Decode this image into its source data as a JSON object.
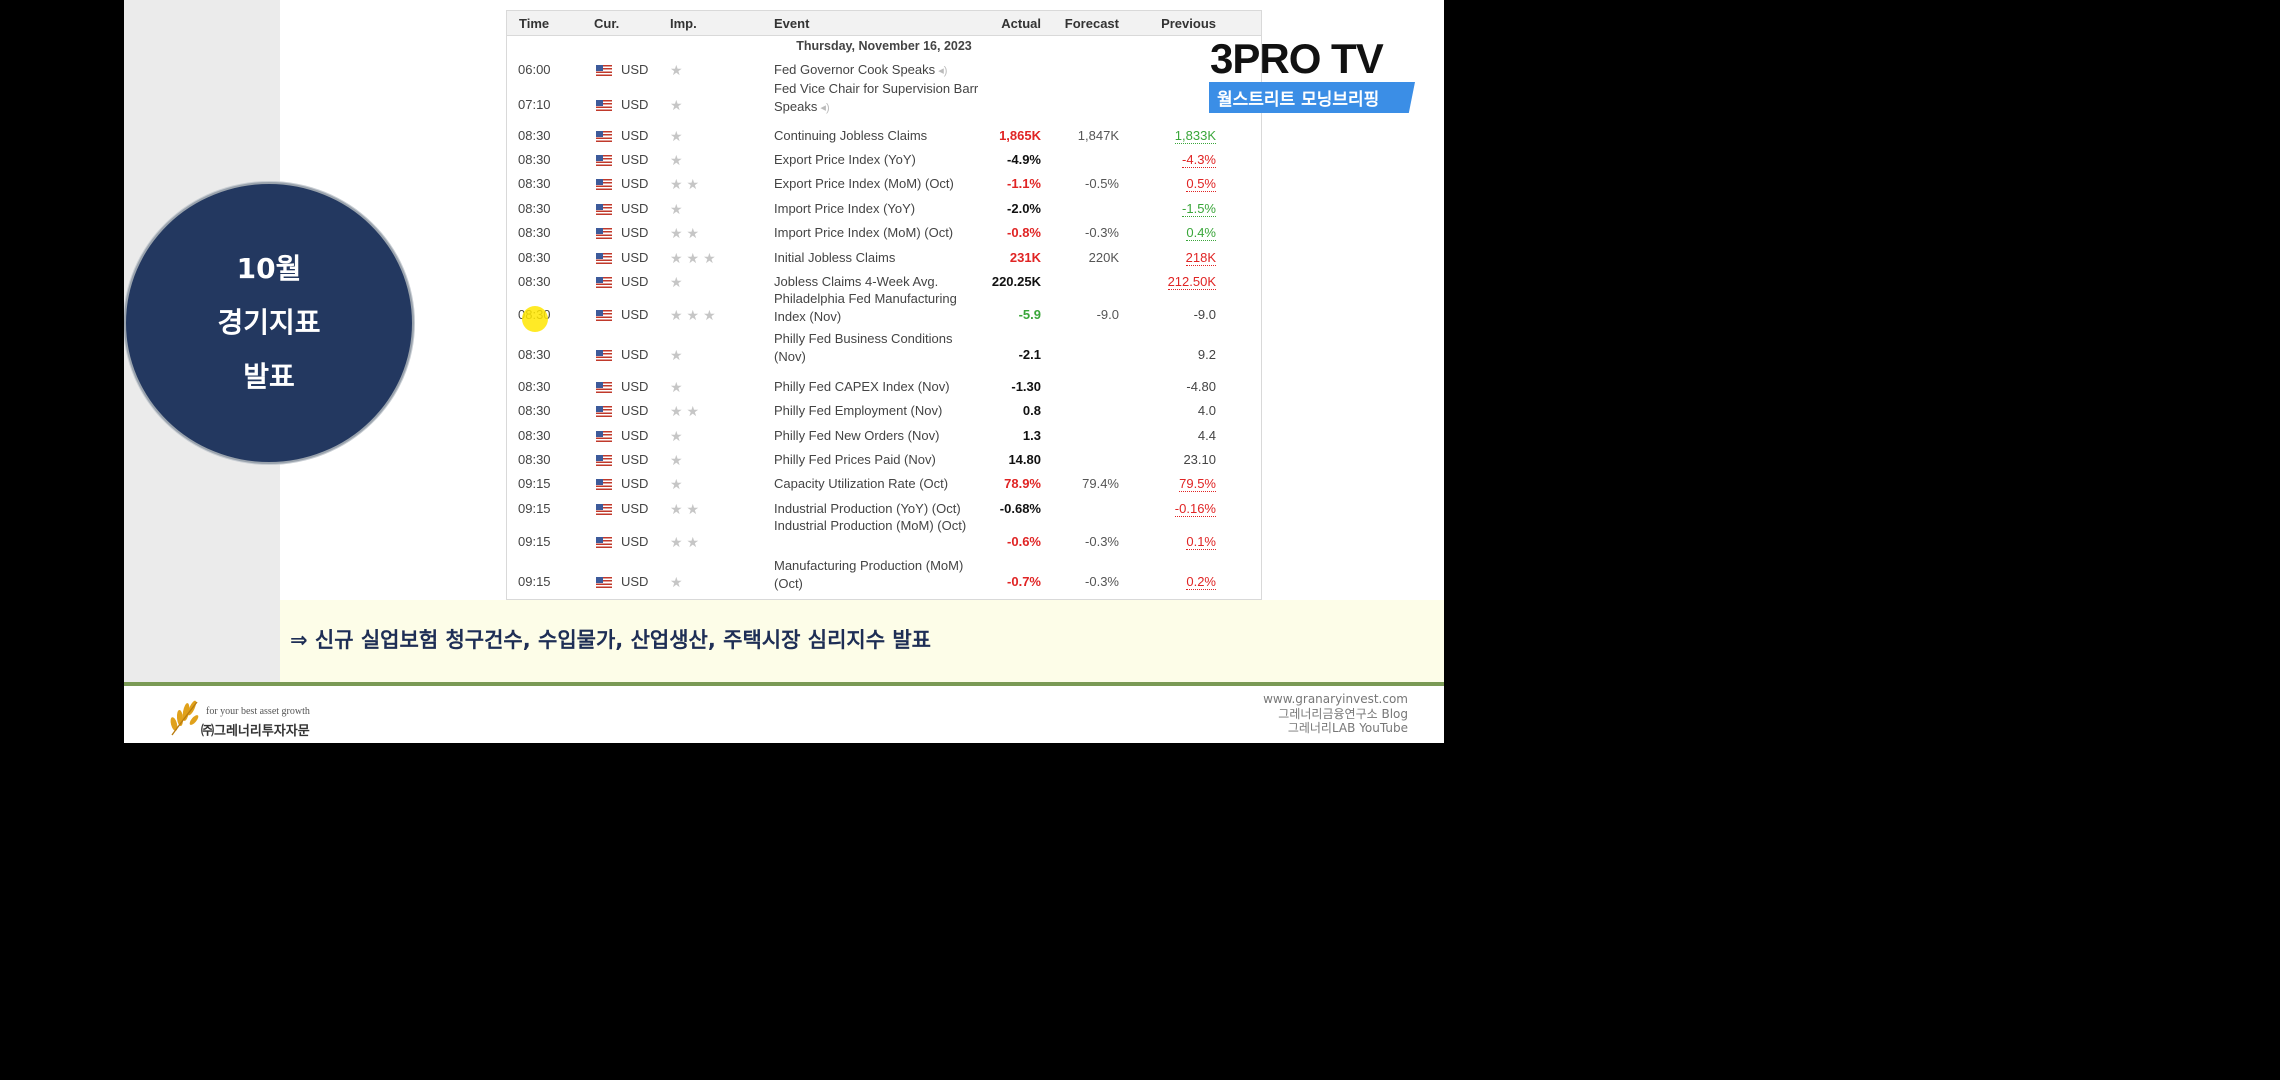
{
  "slide": {
    "circle_lines": [
      "10월",
      "경기지표",
      "발표"
    ],
    "caption": "⇒ 신규 실업보험 청구건수, 수입물가, 산업생산, 주택시장 심리지수 발표"
  },
  "logo": {
    "main": "3PRO TV",
    "sub": "월스트리트 모닝브리핑"
  },
  "calendar": {
    "headers": {
      "time": "Time",
      "cur": "Cur.",
      "imp": "Imp.",
      "event": "Event",
      "actual": "Actual",
      "forecast": "Forecast",
      "previous": "Previous"
    },
    "date": "Thursday, November 16, 2023",
    "rows": [
      {
        "time": "06:00",
        "cur": "USD",
        "imp": 1,
        "event": "Fed Governor Cook Speaks",
        "speech": true,
        "actual": "",
        "forecast": "",
        "previous": ""
      },
      {
        "time": "07:10",
        "cur": "USD",
        "imp": 1,
        "event": "Fed Vice Chair for Supervision Barr Speaks",
        "speech": true,
        "actual": "",
        "forecast": "",
        "previous": ""
      },
      {
        "time": "08:30",
        "cur": "USD",
        "imp": 1,
        "event": "Continuing Jobless Claims",
        "actual": "1,865K",
        "actual_color": "red",
        "forecast": "1,847K",
        "previous": "1,833K",
        "previous_color": "green"
      },
      {
        "time": "08:30",
        "cur": "USD",
        "imp": 1,
        "event": "Export Price Index (YoY)",
        "actual": "-4.9%",
        "actual_color": "black",
        "forecast": "",
        "previous": "-4.3%",
        "previous_color": "red"
      },
      {
        "time": "08:30",
        "cur": "USD",
        "imp": 2,
        "event": "Export Price Index (MoM) (Oct)",
        "actual": "-1.1%",
        "actual_color": "red",
        "forecast": "-0.5%",
        "previous": "0.5%",
        "previous_color": "red"
      },
      {
        "time": "08:30",
        "cur": "USD",
        "imp": 1,
        "event": "Import Price Index (YoY)",
        "actual": "-2.0%",
        "actual_color": "black",
        "forecast": "",
        "previous": "-1.5%",
        "previous_color": "green"
      },
      {
        "time": "08:30",
        "cur": "USD",
        "imp": 2,
        "event": "Import Price Index (MoM) (Oct)",
        "actual": "-0.8%",
        "actual_color": "red",
        "forecast": "-0.3%",
        "previous": "0.4%",
        "previous_color": "green"
      },
      {
        "time": "08:30",
        "cur": "USD",
        "imp": 3,
        "event": "Initial Jobless Claims",
        "actual": "231K",
        "actual_color": "red",
        "forecast": "220K",
        "previous": "218K",
        "previous_color": "red"
      },
      {
        "time": "08:30",
        "cur": "USD",
        "imp": 1,
        "event": "Jobless Claims 4-Week Avg.",
        "actual": "220.25K",
        "actual_color": "black",
        "forecast": "",
        "previous": "212.50K",
        "previous_color": "red"
      },
      {
        "time": "08:30",
        "cur": "USD",
        "imp": 3,
        "event": "Philadelphia Fed Manufacturing Index (Nov)",
        "actual": "-5.9",
        "actual_color": "green",
        "forecast": "-9.0",
        "previous": "-9.0",
        "previous_color": "plain"
      },
      {
        "time": "08:30",
        "cur": "USD",
        "imp": 1,
        "event": "Philly Fed Business Conditions (Nov)",
        "actual": "-2.1",
        "actual_color": "black",
        "forecast": "",
        "previous": "9.2",
        "previous_color": "plain"
      },
      {
        "time": "08:30",
        "cur": "USD",
        "imp": 1,
        "event": "Philly Fed CAPEX Index (Nov)",
        "actual": "-1.30",
        "actual_color": "black",
        "forecast": "",
        "previous": "-4.80",
        "previous_color": "plain"
      },
      {
        "time": "08:30",
        "cur": "USD",
        "imp": 2,
        "event": "Philly Fed Employment (Nov)",
        "actual": "0.8",
        "actual_color": "black",
        "forecast": "",
        "previous": "4.0",
        "previous_color": "plain"
      },
      {
        "time": "08:30",
        "cur": "USD",
        "imp": 1,
        "event": "Philly Fed New Orders (Nov)",
        "actual": "1.3",
        "actual_color": "black",
        "forecast": "",
        "previous": "4.4",
        "previous_color": "plain"
      },
      {
        "time": "08:30",
        "cur": "USD",
        "imp": 1,
        "event": "Philly Fed Prices Paid (Nov)",
        "actual": "14.80",
        "actual_color": "black",
        "forecast": "",
        "previous": "23.10",
        "previous_color": "plain"
      },
      {
        "time": "09:15",
        "cur": "USD",
        "imp": 1,
        "event": "Capacity Utilization Rate (Oct)",
        "actual": "78.9%",
        "actual_color": "red",
        "forecast": "79.4%",
        "previous": "79.5%",
        "previous_color": "red"
      },
      {
        "time": "09:15",
        "cur": "USD",
        "imp": 2,
        "event": "Industrial Production (YoY) (Oct)",
        "actual": "-0.68%",
        "actual_color": "black",
        "forecast": "",
        "previous": "-0.16%",
        "previous_color": "red"
      },
      {
        "time": "09:15",
        "cur": "USD",
        "imp": 2,
        "event": "Industrial Production (MoM) (Oct)",
        "actual": "-0.6%",
        "actual_color": "red",
        "forecast": "-0.3%",
        "previous": "0.1%",
        "previous_color": "red"
      },
      {
        "time": "09:15",
        "cur": "USD",
        "imp": 1,
        "event": "Manufacturing Production (MoM) (Oct)",
        "actual": "-0.7%",
        "actual_color": "red",
        "forecast": "-0.3%",
        "previous": "0.2%",
        "previous_color": "red"
      }
    ]
  },
  "footer": {
    "tagline": "for your best asset growth",
    "company": "㈜그레너리투자자문",
    "links": [
      "www.granaryinvest.com",
      "그레너리금융연구소 Blog",
      "그레너리LAB YouTube"
    ]
  },
  "colors": {
    "circle": "#233860",
    "caption_band": "#fdfde8",
    "accent_blue": "#3b8ee6",
    "green_line": "#7a9a55"
  }
}
